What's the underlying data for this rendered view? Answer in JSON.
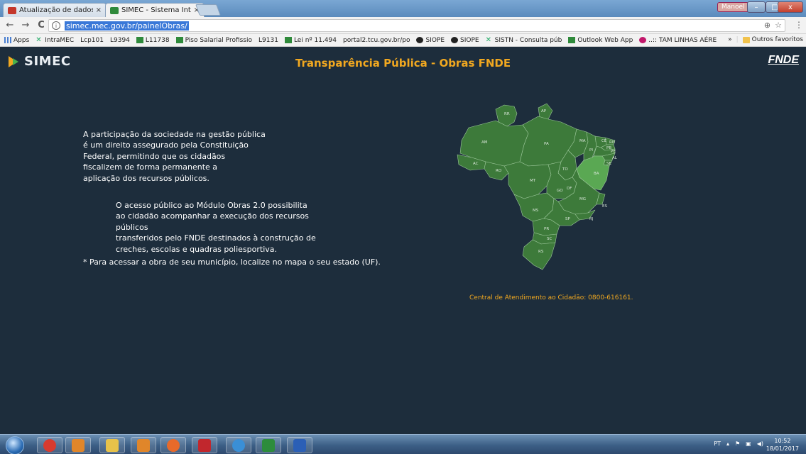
{
  "browser": {
    "tabs": [
      {
        "label": "Atualização de dados - E",
        "close": "×"
      },
      {
        "label": "SIMEC - Sistema Integrad",
        "close": "×"
      }
    ],
    "user_badge": "Manoel",
    "window": {
      "min": "–",
      "max": "□",
      "close": "x"
    },
    "nav": {
      "back": "←",
      "forward": "→",
      "reload": "C"
    },
    "url": "simec.mec.gov.br/painelObras/",
    "info": "i",
    "omni_icons": {
      "zoom": "⊕",
      "star": "☆"
    },
    "menu": "⋮"
  },
  "bookmarks": {
    "items": [
      {
        "label": "Apps",
        "icon": "apps-icon"
      },
      {
        "label": "IntraMEC",
        "icon": "x-icon"
      },
      {
        "label": "Lcp101",
        "icon": "page-icon"
      },
      {
        "label": "L9394",
        "icon": "page-icon"
      },
      {
        "label": "L11738",
        "icon": "brasil-flag-icon"
      },
      {
        "label": "Piso Salarial Profissio",
        "icon": "brasil-flag-icon"
      },
      {
        "label": "L9131",
        "icon": "page-icon"
      },
      {
        "label": "Lei nº 11.494",
        "icon": "brasil-flag-icon"
      },
      {
        "label": "portal2.tcu.gov.br/po",
        "icon": "page-icon"
      },
      {
        "label": "SIOPE",
        "icon": "siope-icon"
      },
      {
        "label": "SIOPE",
        "icon": "siope-icon"
      },
      {
        "label": "SISTN - Consulta púb",
        "icon": "x-icon"
      },
      {
        "label": "Outlook Web App",
        "icon": "brasil-flag-icon"
      },
      {
        "label": "..:: TAM LINHAS AÉRE",
        "icon": "tam-icon"
      }
    ],
    "more": "»",
    "other": "Outros favoritos"
  },
  "page": {
    "logo": "SIMEC",
    "title": "Transparência Pública - Obras FNDE",
    "fnde": "FNDE",
    "intro": "A participação da sociedade na gestão pública\né um direito assegurado pela Constituição\nFederal, permitindo que os cidadãos\nfiscalizem de forma permanente a\naplicação dos recursos públicos.",
    "access": "O acesso público ao Módulo Obras 2.0 possibilita\nao cidadão acompanhar a execução dos recursos públicos\ntransferidos pelo FNDE destinados à construção de\ncreches, escolas e quadras poliesportiva.",
    "instruction": "* Para acessar a obra de seu município, localize no mapa o seu estado (UF).",
    "central": "Central de Atendimento ao Cidadão: 0800-616161.",
    "map": {
      "colors": {
        "state": "#3d7a3a",
        "highlight": "#5aa853",
        "border": "#9cc79a"
      },
      "states": [
        {
          "uf": "RR"
        },
        {
          "uf": "AP"
        },
        {
          "uf": "AM"
        },
        {
          "uf": "PA"
        },
        {
          "uf": "MA"
        },
        {
          "uf": "CE"
        },
        {
          "uf": "RN"
        },
        {
          "uf": "PB"
        },
        {
          "uf": "PE"
        },
        {
          "uf": "PI"
        },
        {
          "uf": "AL"
        },
        {
          "uf": "SE"
        },
        {
          "uf": "BA"
        },
        {
          "uf": "AC"
        },
        {
          "uf": "RO"
        },
        {
          "uf": "MT"
        },
        {
          "uf": "TO"
        },
        {
          "uf": "DF"
        },
        {
          "uf": "GO"
        },
        {
          "uf": "MG"
        },
        {
          "uf": "ES"
        },
        {
          "uf": "MS"
        },
        {
          "uf": "SP"
        },
        {
          "uf": "RJ"
        },
        {
          "uf": "PR"
        },
        {
          "uf": "SC"
        },
        {
          "uf": "RS"
        }
      ]
    }
  },
  "taskbar": {
    "apps": [
      {
        "name": "chrome",
        "color": "#d83b2f"
      },
      {
        "name": "outlook",
        "color": "#e0862a"
      },
      {
        "name": "explorer",
        "color": "#e7c24a"
      },
      {
        "name": "media",
        "color": "#e0862a"
      },
      {
        "name": "firefox",
        "color": "#e86a2a"
      },
      {
        "name": "acrobat",
        "color": "#c1272d"
      },
      {
        "name": "ie",
        "color": "#3a8fd6"
      },
      {
        "name": "excel",
        "color": "#2d8c3c"
      },
      {
        "name": "word",
        "color": "#2b5fb6"
      }
    ],
    "tray": {
      "lang": "PT",
      "up": "▴"
    },
    "time": "10:52",
    "date": "18/01/2017"
  }
}
